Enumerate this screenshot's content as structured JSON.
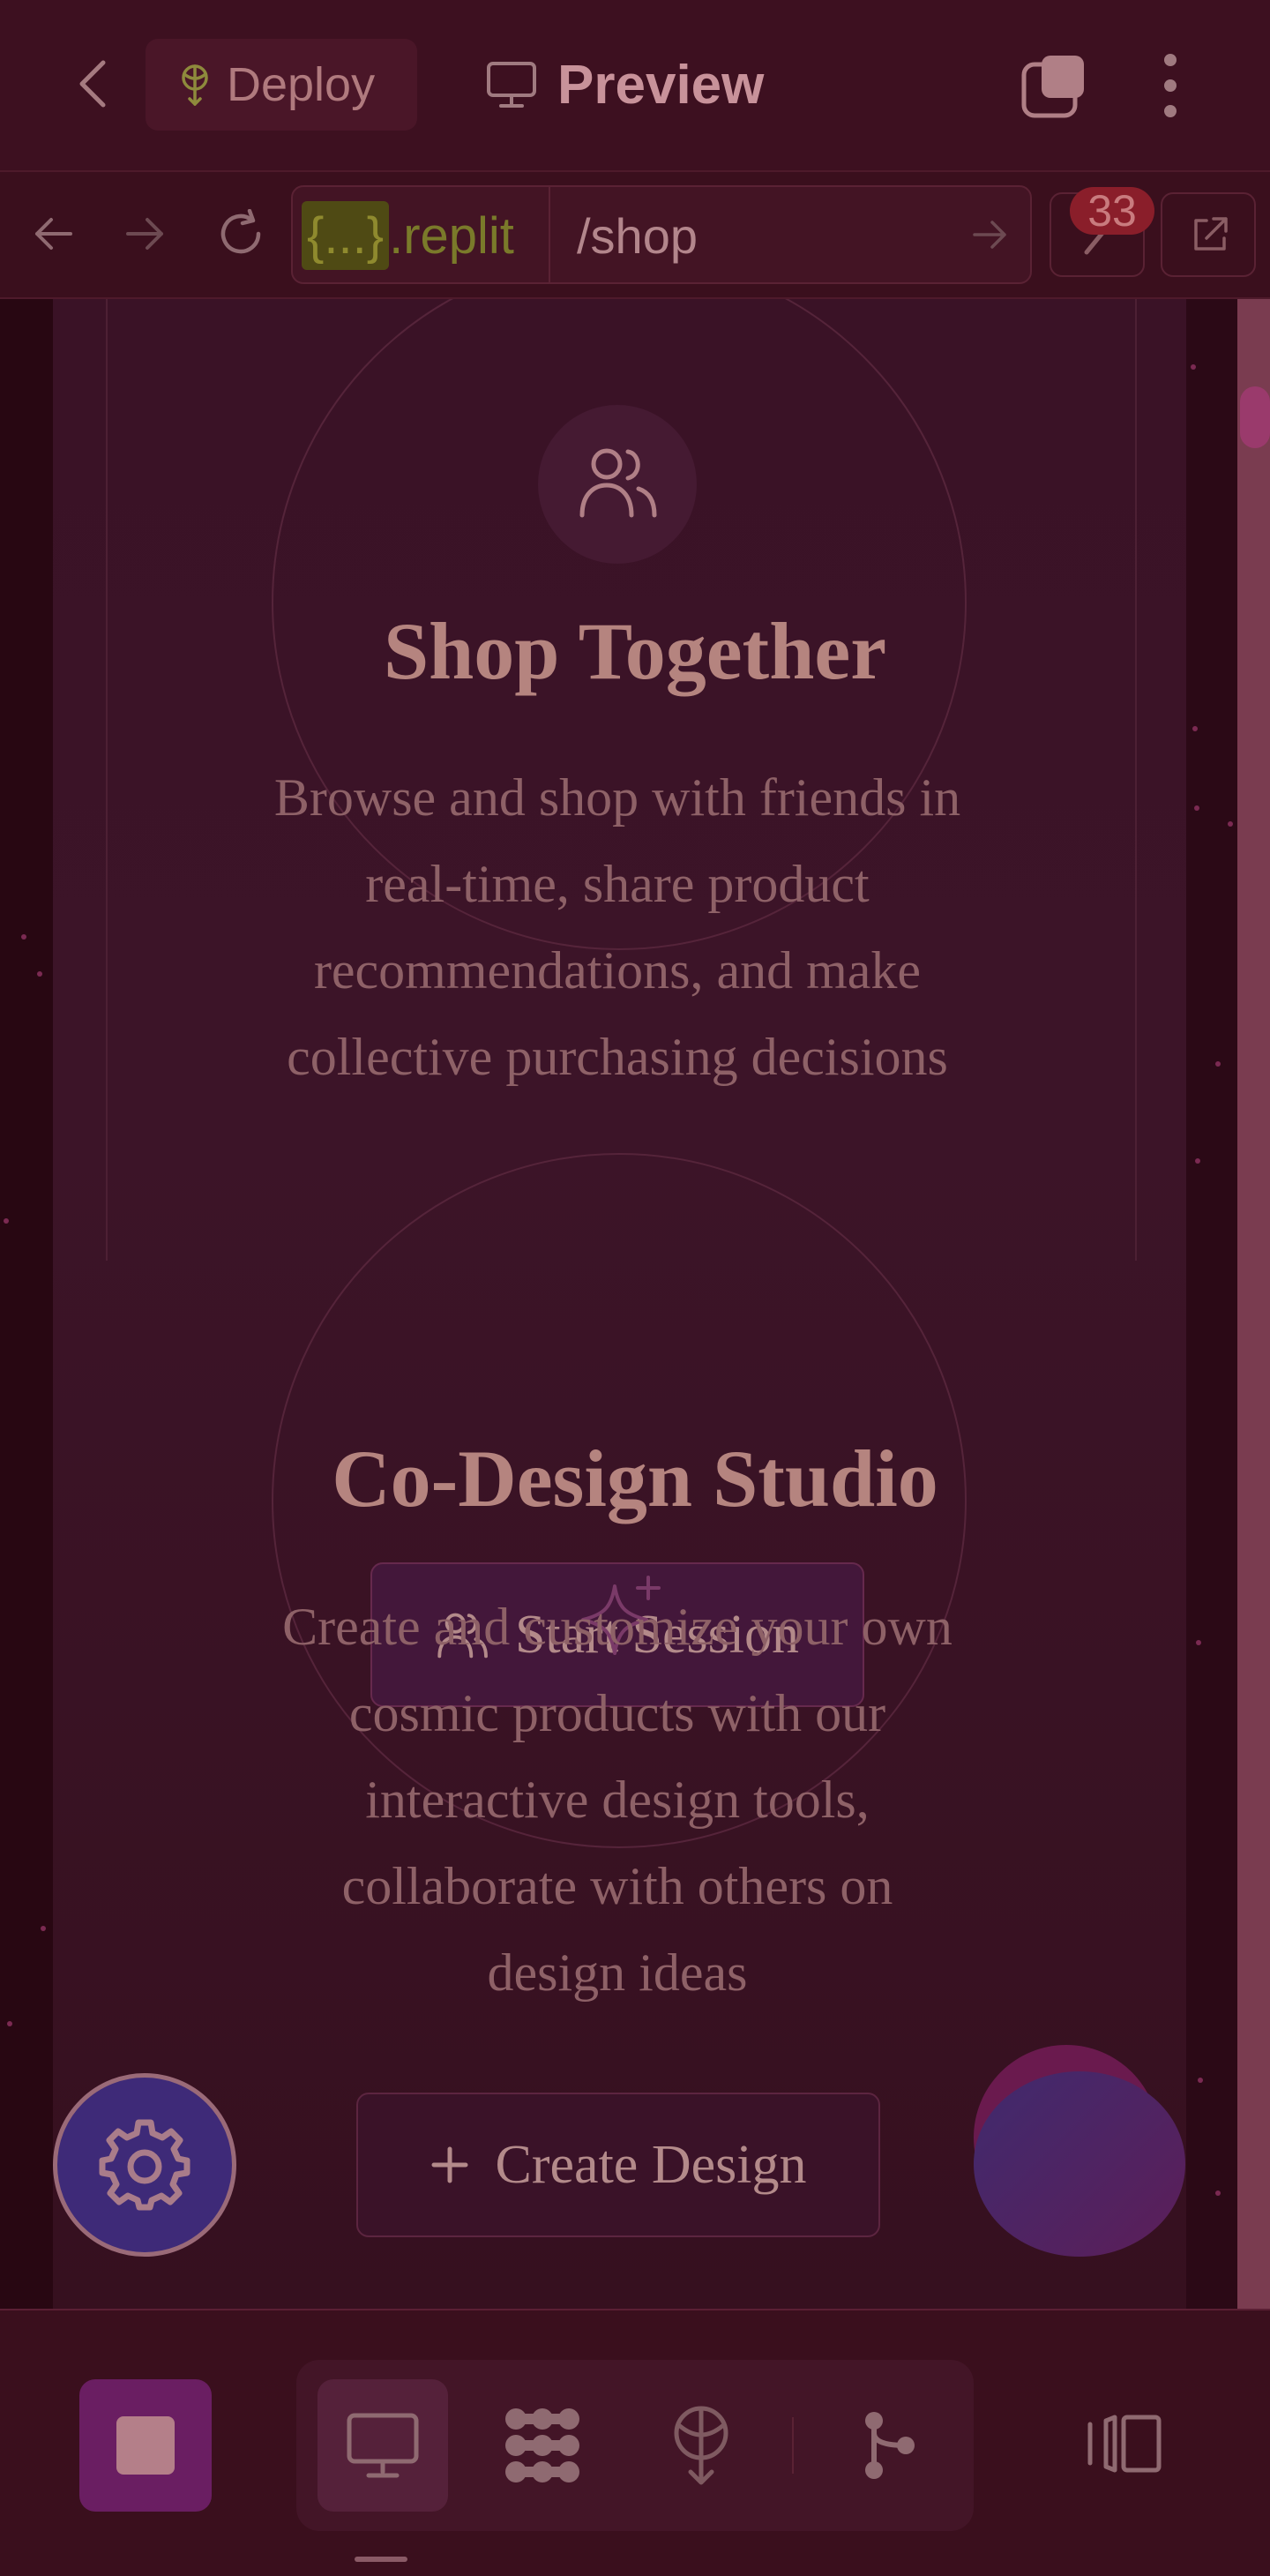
{
  "header": {
    "deploy_label": "Deploy",
    "preview_label": "Preview"
  },
  "browser": {
    "domain_brace": "{...}",
    "domain_host": ".replit",
    "path": "/shop",
    "devtools_badge": "33"
  },
  "page": {
    "shop_together": {
      "title": "Shop Together",
      "description": "Browse and shop with friends in real-time, share product recommendations, and make collective purchasing decisions",
      "button_label": "Start Session"
    },
    "co_design": {
      "title": "Co-Design Studio",
      "description": "Create and customize your own cosmic products with our interactive design tools, collaborate with others on design ideas",
      "button_label": "Create Design"
    }
  },
  "icons": {
    "back": "chevron-left-icon",
    "deploy": "deploy-icon",
    "preview": "monitor-icon",
    "tabs": "tabs-icon",
    "more": "more-vertical-icon",
    "users": "users-icon",
    "sparkle": "sparkle-icon",
    "plus": "plus-icon",
    "gear": "gear-icon"
  },
  "colors": {
    "overlay": "#3a111d",
    "accent_purple": "#6a1e62",
    "text": "#b5847f"
  }
}
